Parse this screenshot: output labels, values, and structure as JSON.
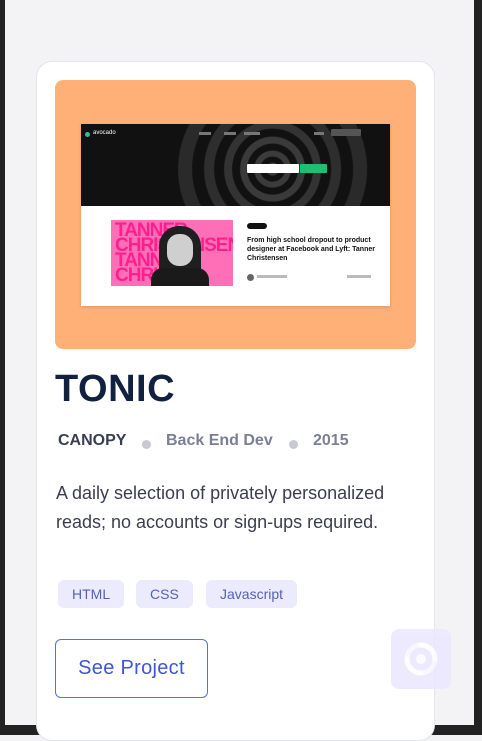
{
  "project": {
    "thumbnail": {
      "brand": "avocado",
      "feature_title": "From high school dropout to product designer at Facebook and Lyft: Tanner Christensen",
      "feature_words": [
        "TANNER",
        "CHRISTENSEN",
        "TANNER",
        "CHRIS"
      ]
    },
    "title": "TONIC",
    "meta": {
      "client": "CANOPY",
      "role": "Back End Dev",
      "year": "2015"
    },
    "description": "A daily selection of privately personalized reads; no accounts or sign-ups required.",
    "tags": [
      "HTML",
      "CSS",
      "Javascript"
    ],
    "cta_label": "See Project"
  },
  "colors": {
    "thumbnail_bg": "#ffb077",
    "title": "#12213f",
    "tag_bg": "#ecebfd",
    "tag_text": "#5561b8",
    "button_border": "#5a6fdc",
    "button_text": "#3d55d8"
  },
  "icons": {
    "float_button": "spiral-icon"
  }
}
